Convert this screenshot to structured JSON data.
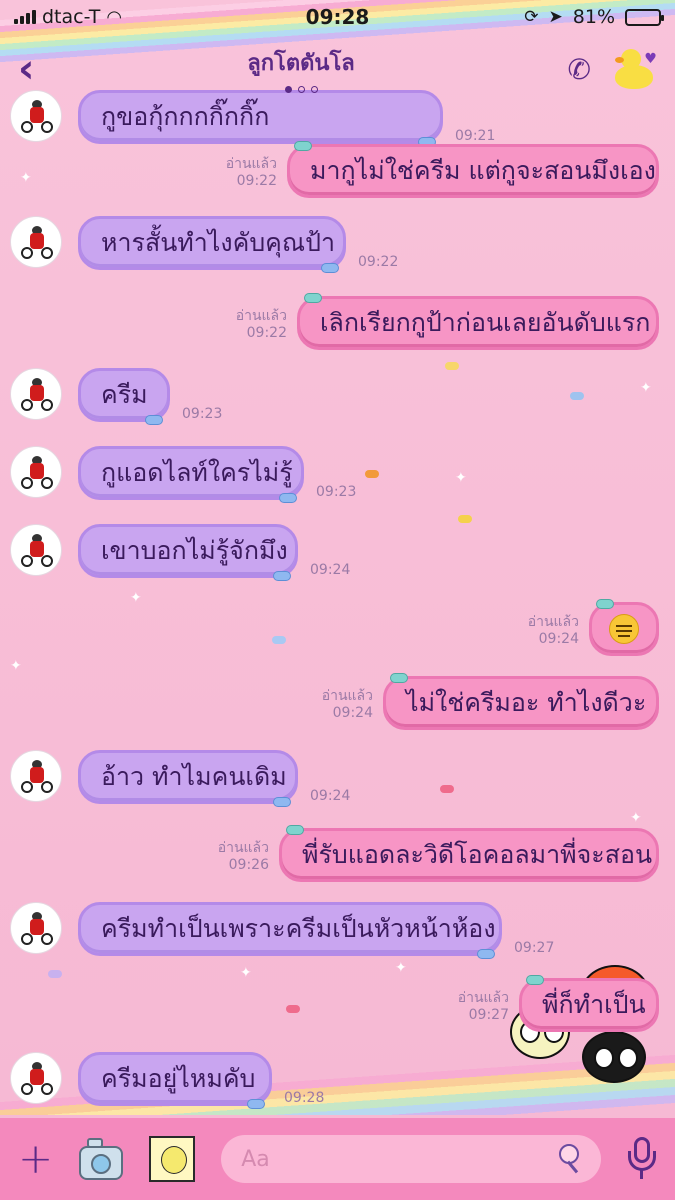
{
  "status_bar": {
    "carrier": "dtac-T",
    "time": "09:28",
    "battery_percent": "81%",
    "battery_level": 0.81
  },
  "header": {
    "back_icon": "chevron-left-icon",
    "title": "ลูกโตดันโล",
    "page_dots": [
      true,
      false,
      false
    ],
    "call_icon": "phone-icon"
  },
  "messages": [
    {
      "dir": "in",
      "text": "กูขอกุ้กกกกิ๊กกิ๊ก",
      "time": "09:21"
    },
    {
      "dir": "out",
      "text": "มากูไม่ใช่ครีม แต่กูจะสอนมึงเอง",
      "read": "อ่านแล้ว",
      "time": "09:22"
    },
    {
      "dir": "in",
      "text": "หารสั้นทำไงคับคุณป้า",
      "time": "09:22"
    },
    {
      "dir": "out",
      "text": "เลิกเรียกกูป้าก่อนเลยอันดับแรก",
      "read": "อ่านแล้ว",
      "time": "09:22"
    },
    {
      "dir": "in",
      "text": "ครีม",
      "time": "09:23"
    },
    {
      "dir": "in",
      "text": "กูแอดไลท์ใครไม่รู้",
      "time": "09:23"
    },
    {
      "dir": "in",
      "text": "เขาบอกไม่รู้จักมึง",
      "time": "09:24"
    },
    {
      "dir": "out",
      "text": "",
      "emoji": "expressionless-face-emoji",
      "read": "อ่านแล้ว",
      "time": "09:24"
    },
    {
      "dir": "out",
      "text": "ไม่ใช่ครีมอะ ทำไงดีวะ",
      "read": "อ่านแล้ว",
      "time": "09:24"
    },
    {
      "dir": "in",
      "text": "อ้าว ทำไมคนเดิม",
      "time": "09:24"
    },
    {
      "dir": "out",
      "text": "พี่รับแอดละวิดีโอคอลมาพี่จะสอน",
      "read": "อ่านแล้ว",
      "time": "09:26"
    },
    {
      "dir": "in",
      "text": "ครีมทำเป็นเพราะครีมเป็นหัวหน้าห้อง",
      "time": "09:27"
    },
    {
      "dir": "out",
      "text": "พี่ก็ทำเป็น",
      "read": "อ่านแล้ว",
      "time": "09:27"
    },
    {
      "dir": "in",
      "text": "ครีมอยู่ไหมคับ",
      "time": "09:28"
    }
  ],
  "input_bar": {
    "placeholder": "Aa",
    "icons": [
      "plus-icon",
      "camera-icon",
      "sticker-icon",
      "emoji-lollipop-icon",
      "microphone-icon"
    ]
  },
  "colors": {
    "background": "#f7bdd6",
    "incoming_bubble": "#c9a5f0",
    "outgoing_bubble": "#f795c5",
    "accent": "#5b2a86",
    "input_bar": "#f489bd"
  }
}
